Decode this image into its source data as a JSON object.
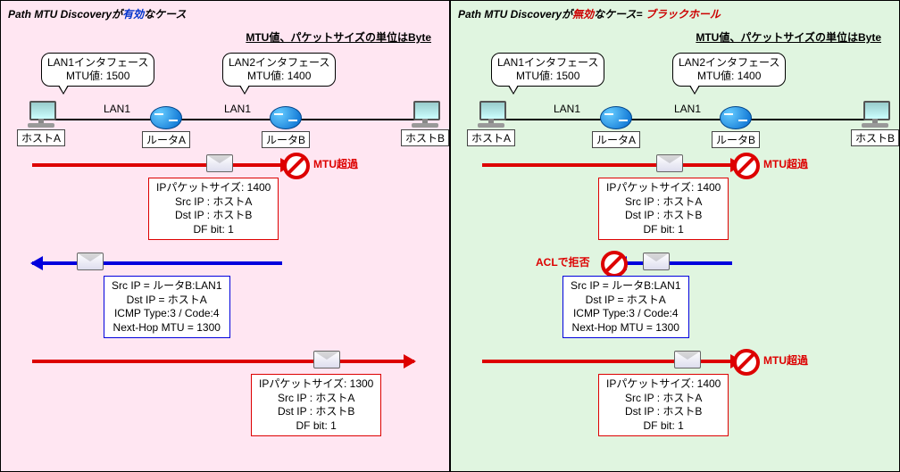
{
  "left": {
    "title_pre": "Path MTU Discovery",
    "title_mid": "が",
    "title_hl": "有効",
    "title_post": "なケース",
    "subtitle": "MTU値、パケットサイズの単位はByte",
    "balloon_lan1_l1": "LAN1インタフェース",
    "balloon_lan1_l2": "MTU値: 1500",
    "balloon_lan2_l1": "LAN2インタフェース",
    "balloon_lan2_l2": "MTU値: 1400",
    "lan1a": "LAN1",
    "lan1b": "LAN1",
    "hostA": "ホストA",
    "routerA": "ルータA",
    "routerB": "ルータB",
    "hostB": "ホストB",
    "mtu_over": "MTU超過",
    "pkt1_l1": "IPパケットサイズ: 1400",
    "pkt1_l2": "Src IP : ホストA",
    "pkt1_l3": "Dst IP : ホストB",
    "pkt1_l4": "DF bit:  1",
    "icmp_l1": "Src IP = ルータB:LAN1",
    "icmp_l2": "Dst IP = ホストA",
    "icmp_l3": "ICMP Type:3  / Code:4",
    "icmp_l4": "Next-Hop MTU = 1300",
    "pkt2_l1": "IPパケットサイズ: 1300",
    "pkt2_l2": "Src IP : ホストA",
    "pkt2_l3": "Dst IP : ホストB",
    "pkt2_l4": "DF bit:  1"
  },
  "right": {
    "title_pre": "Path MTU Discovery",
    "title_mid": "が",
    "title_hl": "無効",
    "title_post": "なケース= ",
    "title_extra": "ブラックホール",
    "subtitle": "MTU値、パケットサイズの単位はByte",
    "balloon_lan1_l1": "LAN1インタフェース",
    "balloon_lan1_l2": "MTU値: 1500",
    "balloon_lan2_l1": "LAN2インタフェース",
    "balloon_lan2_l2": "MTU値: 1400",
    "lan1a": "LAN1",
    "lan1b": "LAN1",
    "hostA": "ホストA",
    "routerA": "ルータA",
    "routerB": "ルータB",
    "hostB": "ホストB",
    "mtu_over1": "MTU超過",
    "acl_deny": "ACLで拒否",
    "mtu_over2": "MTU超過",
    "pkt1_l1": "IPパケットサイズ: 1400",
    "pkt1_l2": "Src IP : ホストA",
    "pkt1_l3": "Dst IP : ホストB",
    "pkt1_l4": "DF bit:  1",
    "icmp_l1": "Src IP = ルータB:LAN1",
    "icmp_l2": "Dst IP = ホストA",
    "icmp_l3": "ICMP Type:3  / Code:4",
    "icmp_l4": "Next-Hop MTU = 1300",
    "pkt2_l1": "IPパケットサイズ: 1400",
    "pkt2_l2": "Src IP : ホストA",
    "pkt2_l3": "Dst IP : ホストB",
    "pkt2_l4": "DF bit:  1"
  }
}
